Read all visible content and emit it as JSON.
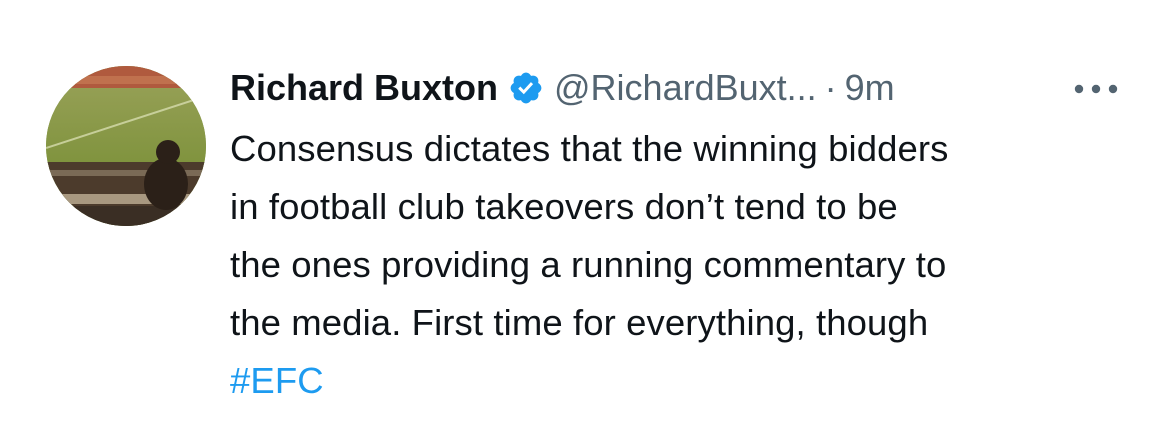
{
  "tweet": {
    "author": {
      "display_name": "Richard Buxton",
      "handle": "@RichardBuxt...",
      "verified": true,
      "avatar_icon": "avatar-football-stadium"
    },
    "separator": "·",
    "timestamp": "9m",
    "more_icon": "more-horizontal-icon",
    "text_lines": [
      "Consensus dictates that the winning bidders",
      "in football club takeovers don’t tend to be",
      "the ones providing a running commentary to",
      "the media. First time for everything, though"
    ],
    "hashtag": "#EFC"
  },
  "colors": {
    "text": "#0f1419",
    "secondary": "#536471",
    "link": "#1d9bf0",
    "verified_badge": "#1d9bf0"
  }
}
